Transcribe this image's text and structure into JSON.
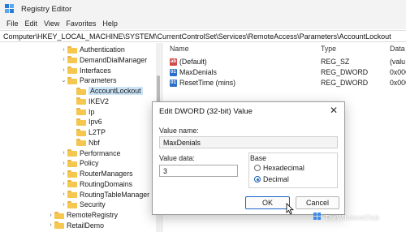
{
  "window": {
    "title": "Registry Editor"
  },
  "menu": [
    "File",
    "Edit",
    "View",
    "Favorites",
    "Help"
  ],
  "address": "Computer\\HKEY_LOCAL_MACHINE\\SYSTEM\\CurrentControlSet\\Services\\RemoteAccess\\Parameters\\AccountLockout",
  "tree": {
    "items": [
      {
        "label": "Authentication",
        "depth": 3,
        "expander": ">"
      },
      {
        "label": "DemandDialManager",
        "depth": 3,
        "expander": ">"
      },
      {
        "label": "Interfaces",
        "depth": 3,
        "expander": ">"
      },
      {
        "label": "Parameters",
        "depth": 3,
        "expander": "v"
      },
      {
        "label": "AccountLockout",
        "depth": 4,
        "expander": "",
        "selected": true
      },
      {
        "label": "IKEV2",
        "depth": 4,
        "expander": ""
      },
      {
        "label": "Ip",
        "depth": 4,
        "expander": ""
      },
      {
        "label": "Ipv6",
        "depth": 4,
        "expander": ""
      },
      {
        "label": "L2TP",
        "depth": 4,
        "expander": ""
      },
      {
        "label": "Nbf",
        "depth": 4,
        "expander": ""
      },
      {
        "label": "Performance",
        "depth": 3,
        "expander": ">"
      },
      {
        "label": "Policy",
        "depth": 3,
        "expander": ">"
      },
      {
        "label": "RouterManagers",
        "depth": 3,
        "expander": ">"
      },
      {
        "label": "RoutingDomains",
        "depth": 3,
        "expander": ">"
      },
      {
        "label": "RoutingTableManager",
        "depth": 3,
        "expander": ">"
      },
      {
        "label": "Security",
        "depth": 3,
        "expander": ">"
      },
      {
        "label": "RemoteRegistry",
        "depth": 2,
        "expander": ">"
      },
      {
        "label": "RetailDemo",
        "depth": 2,
        "expander": ">"
      }
    ]
  },
  "values": {
    "headers": {
      "name": "Name",
      "type": "Type",
      "data": "Data"
    },
    "rows": [
      {
        "icon": "string-value-icon",
        "name": "(Default)",
        "type": "REG_SZ",
        "data": "(valu"
      },
      {
        "icon": "dword-value-icon",
        "name": "MaxDenials",
        "type": "REG_DWORD",
        "data": "0x000"
      },
      {
        "icon": "dword-value-icon",
        "name": "ResetTime (mins)",
        "type": "REG_DWORD",
        "data": "0x000"
      }
    ]
  },
  "dialog": {
    "title": "Edit DWORD (32-bit) Value",
    "close_glyph": "✕",
    "value_name_label": "Value name:",
    "value_name": "MaxDenials",
    "value_data_label": "Value data:",
    "value_data": "3",
    "base_label": "Base",
    "hex_label": "Hexadecimal",
    "dec_label": "Decimal",
    "selected_base": "Decimal",
    "ok_label": "OK",
    "cancel_label": "Cancel"
  },
  "watermark": "TheWindowsClub",
  "colors": {
    "accent": "#1a63c6",
    "folder": "#f5c74f",
    "selection": "#cce4f7"
  }
}
